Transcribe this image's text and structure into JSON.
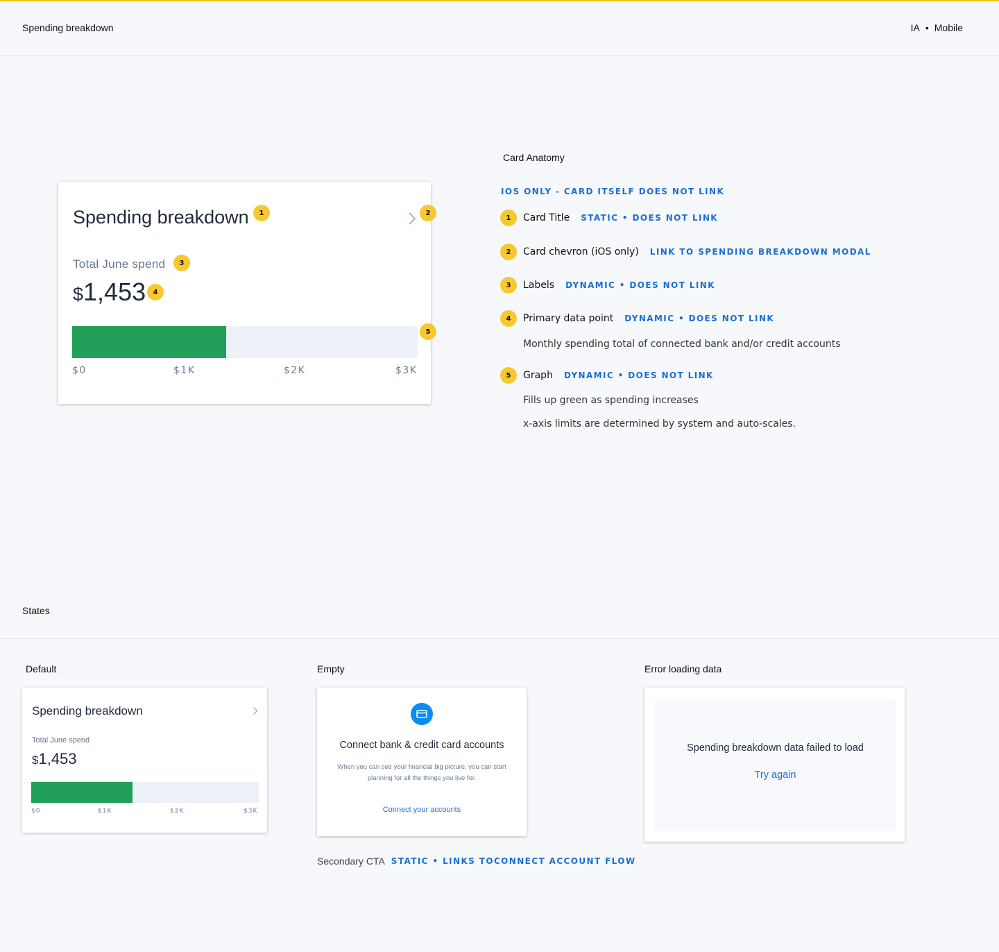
{
  "header": {
    "title": "Spending breakdown",
    "meta_left": "IA",
    "meta_sep": "•",
    "meta_right": "Mobile"
  },
  "colors": {
    "accent_yellow": "#f7c31a",
    "badge_yellow": "#f8c82f",
    "link_blue": "#1a6fd3",
    "bar_green": "#22a05a",
    "bar_track": "#edf2f8"
  },
  "card": {
    "title": "Spending breakdown",
    "label": "Total June spend",
    "currency": "$",
    "amount": "1,453",
    "progress_fraction": 0.445,
    "ticks": [
      "$0",
      "$1K",
      "$2K",
      "$3K"
    ],
    "chevron_icon": "chevron-right-icon"
  },
  "badges": [
    "1",
    "2",
    "3",
    "4",
    "5"
  ],
  "anatomy": {
    "title": "Card Anatomy",
    "ios_note": "IOS ONLY - CARD ITSELF DOES NOT LINK",
    "items": [
      {
        "num": "1",
        "label": "Card Title",
        "note": "STATIC • DOES NOT LINK"
      },
      {
        "num": "2",
        "label": "Card chevron (iOS only)",
        "note": "LINK TO SPENDING BREAKDOWN MODAL"
      },
      {
        "num": "3",
        "label": "Labels",
        "note": "DYNAMIC • DOES NOT LINK"
      },
      {
        "num": "4",
        "label": "Primary data point",
        "note": "DYNAMIC • DOES NOT LINK"
      },
      {
        "num": "5",
        "label": "Graph",
        "note": "DYNAMIC • DOES NOT LINK"
      }
    ],
    "desc_4": "Monthly spending total of connected bank and/or credit accounts",
    "desc_5a": "Fills up green as spending increases",
    "desc_5b": "x-axis limits are determined by system and auto-scales."
  },
  "states": {
    "title": "States",
    "default_label": "Default",
    "empty_label": "Empty",
    "error_label": "Error loading data",
    "empty": {
      "icon": "credit-card-icon",
      "title": "Connect bank & credit card accounts",
      "body": "When you can see your financial big picture, you can start planning for all the things you live for.",
      "link": "Connect your accounts"
    },
    "secondary_cta_label": "Secondary CTA",
    "secondary_cta_note": "STATIC • LINKS TOCONNECT ACCOUNT FLOW",
    "error": {
      "message": "Spending breakdown data failed to load",
      "retry": "Try again"
    }
  }
}
